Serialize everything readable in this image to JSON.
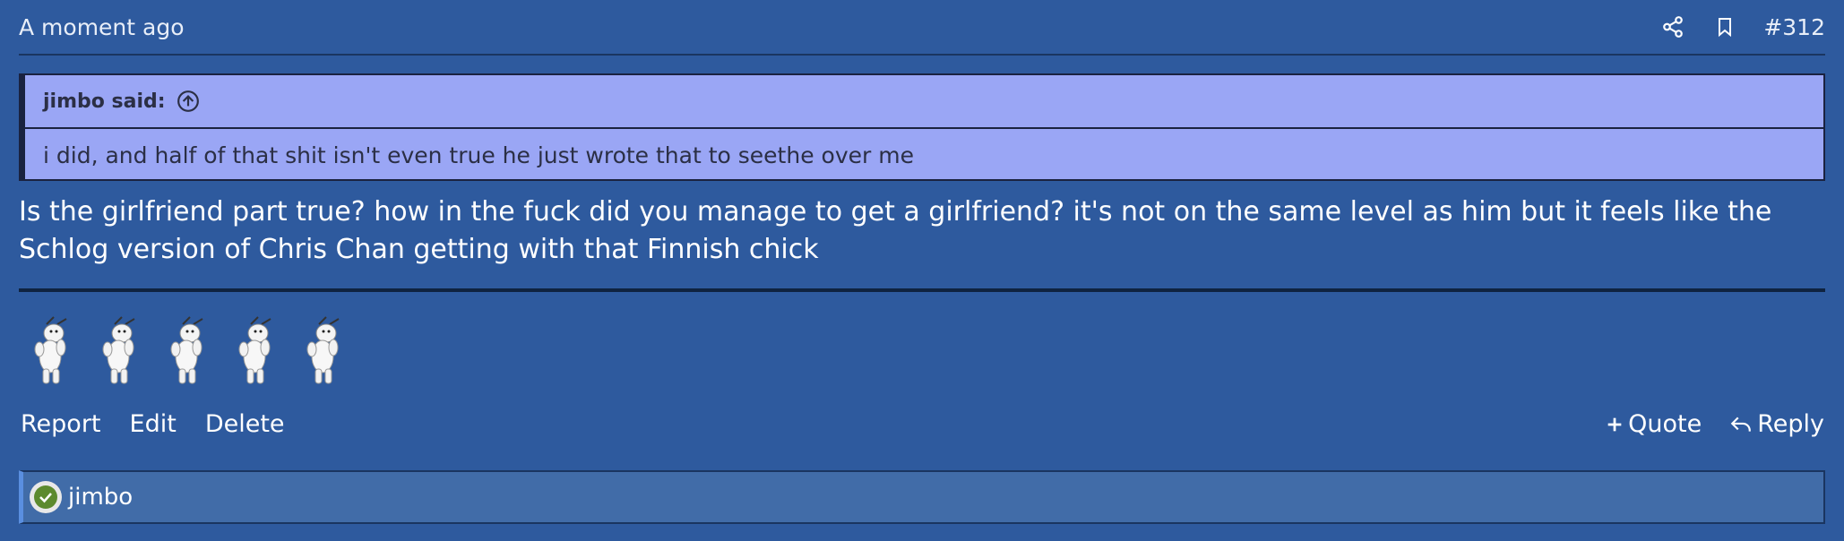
{
  "post": {
    "timestamp": "A moment ago",
    "number": "#312",
    "share_icon": "share-icon",
    "bookmark_icon": "bookmark-icon"
  },
  "quote": {
    "author_label": "jimbo said:",
    "jump_icon": "arrow-up-circle-icon",
    "text": "i did, and half of that shit isn't even true he just wrote that to seethe over me"
  },
  "message": {
    "line1": "Is the girlfriend part true? how in the fuck did you manage to get a girlfriend? it's not on the same level as him but it feels like the",
    "line2": "Schlog version of Chris Chan getting with that Finnish chick"
  },
  "reactions": {
    "count_shown": 5,
    "icon": "dancing-yeti-icon"
  },
  "actions": {
    "report": "Report",
    "edit": "Edit",
    "delete": "Delete",
    "quote": "Quote",
    "reply": "Reply"
  },
  "reacted_by": {
    "user": "jimbo",
    "badge_icon": "check-circle-icon"
  },
  "colors": {
    "background": "#2e5a9e",
    "quote_bg": "#9aa6f5",
    "reacted_bar_bg": "#416ca8"
  }
}
